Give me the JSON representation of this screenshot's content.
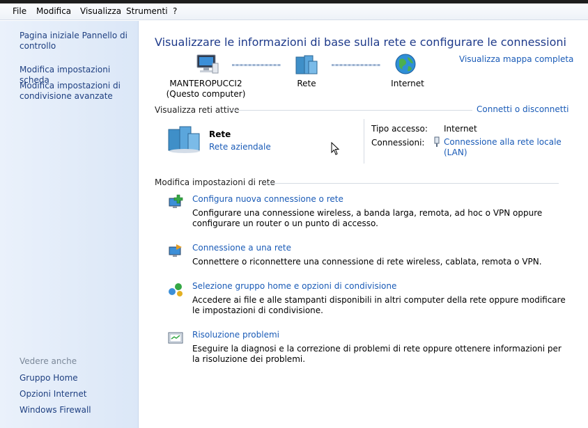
{
  "menubar": {
    "items": [
      {
        "label": "File"
      },
      {
        "label": "Modifica"
      },
      {
        "label": "Visualizza"
      },
      {
        "label": "Strumenti"
      },
      {
        "label": "?"
      }
    ]
  },
  "sidebar": {
    "links": [
      "Pagina iniziale Pannello di controllo",
      "Modifica impostazioni scheda",
      "Modifica impostazioni di condivisione avanzate"
    ],
    "see_also_label": "Vedere anche",
    "see_also": [
      "Gruppo Home",
      "Opzioni Internet",
      "Windows Firewall"
    ]
  },
  "main": {
    "title": "Visualizzare le informazioni di base sulla rete e configurare le connessioni",
    "map_link": "Visualizza mappa completa",
    "nodes": {
      "computer_name": "MANTEROPUCCI2",
      "computer_sub": "(Questo computer)",
      "network": "Rete",
      "internet": "Internet"
    },
    "active": {
      "heading": "Visualizza reti attive",
      "connect_link": "Connetti o disconnetti",
      "network_name": "Rete",
      "network_type": "Rete aziendale",
      "access_label": "Tipo accesso:",
      "access_value": "Internet",
      "connections_label": "Connessioni:",
      "connection_link": "Connessione alla rete locale (LAN)"
    },
    "settings": {
      "heading": "Modifica impostazioni di rete",
      "tasks": [
        {
          "title": "Configura nuova connessione o rete",
          "desc": "Configurare una connessione wireless, a banda larga, remota, ad hoc o VPN oppure configurare un router o un punto di accesso."
        },
        {
          "title": "Connessione a una rete",
          "desc": "Connettere o riconnettere una connessione di rete wireless, cablata, remota o VPN."
        },
        {
          "title": "Selezione gruppo home e opzioni di condivisione",
          "desc": "Accedere ai file e alle stampanti disponibili in altri computer della rete oppure modificare le impostazioni di condivisione."
        },
        {
          "title": "Risoluzione problemi",
          "desc": "Eseguire la diagnosi e la correzione di problemi di rete oppure ottenere informazioni per la risoluzione dei problemi."
        }
      ]
    }
  }
}
